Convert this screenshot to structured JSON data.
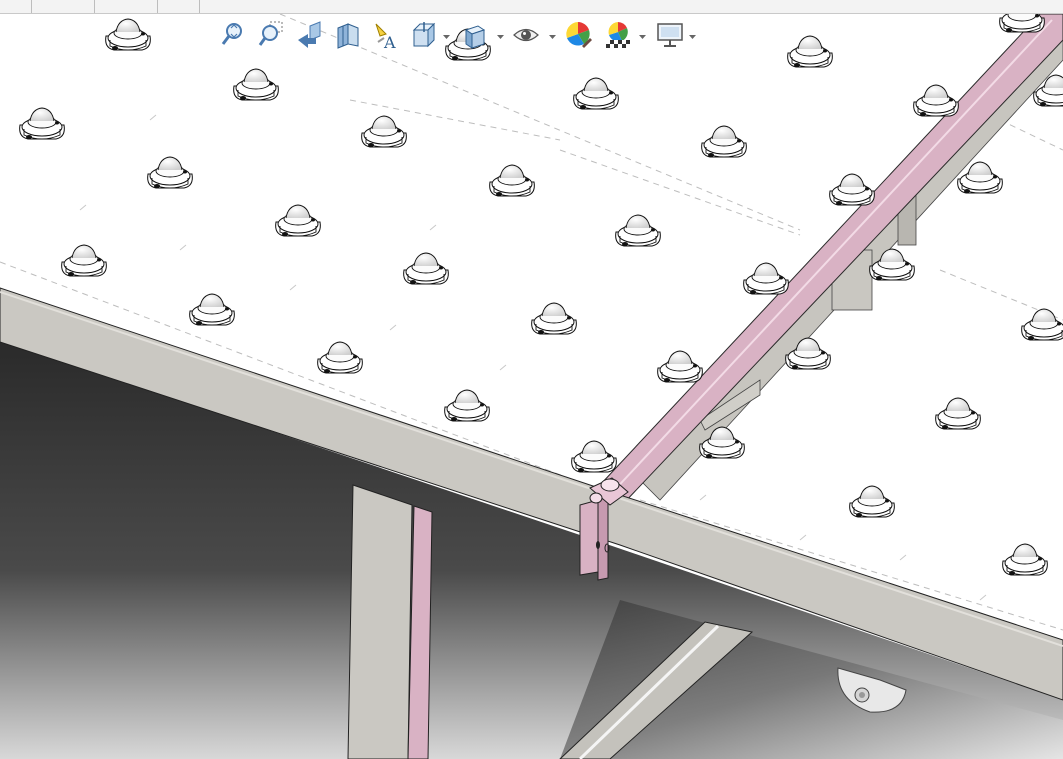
{
  "app": {
    "title": ""
  },
  "tabs": [
    "",
    "",
    "",
    ""
  ],
  "heads_up_toolbar": {
    "buttons": [
      {
        "id": "zoom-to-fit",
        "icon": "zoom-to-fit-icon"
      },
      {
        "id": "zoom-to-area",
        "icon": "zoom-to-area-icon"
      },
      {
        "id": "previous-view",
        "icon": "previous-view-icon"
      },
      {
        "id": "section-view",
        "icon": "section-view-icon"
      },
      {
        "id": "dynamic-annotation-views",
        "icon": "annotation-views-icon"
      },
      {
        "id": "view-orientation",
        "icon": "view-orientation-icon",
        "dropdown": true
      },
      {
        "id": "display-style",
        "icon": "display-style-icon",
        "dropdown": true
      },
      {
        "id": "hide-show-items",
        "icon": "eye-icon",
        "dropdown": true
      },
      {
        "id": "edit-appearance",
        "icon": "edit-appearance-icon"
      },
      {
        "id": "apply-scene",
        "icon": "apply-scene-icon",
        "dropdown": true
      },
      {
        "id": "view-settings",
        "icon": "monitor-icon",
        "dropdown": true
      }
    ]
  },
  "model": {
    "table_top_color": "#ffffff",
    "frame_color": "#cac8c2",
    "frame_edge_color": "#e2e0db",
    "selected_part_color": "#d9b2c4",
    "highlight_color": "#e98fc4",
    "shadow_dark": "#262626",
    "shadow_light": "#cfcfcf",
    "ball_transfer_unit": "ball-transfer-unit-icon",
    "caster": "caster-wheel-icon"
  }
}
